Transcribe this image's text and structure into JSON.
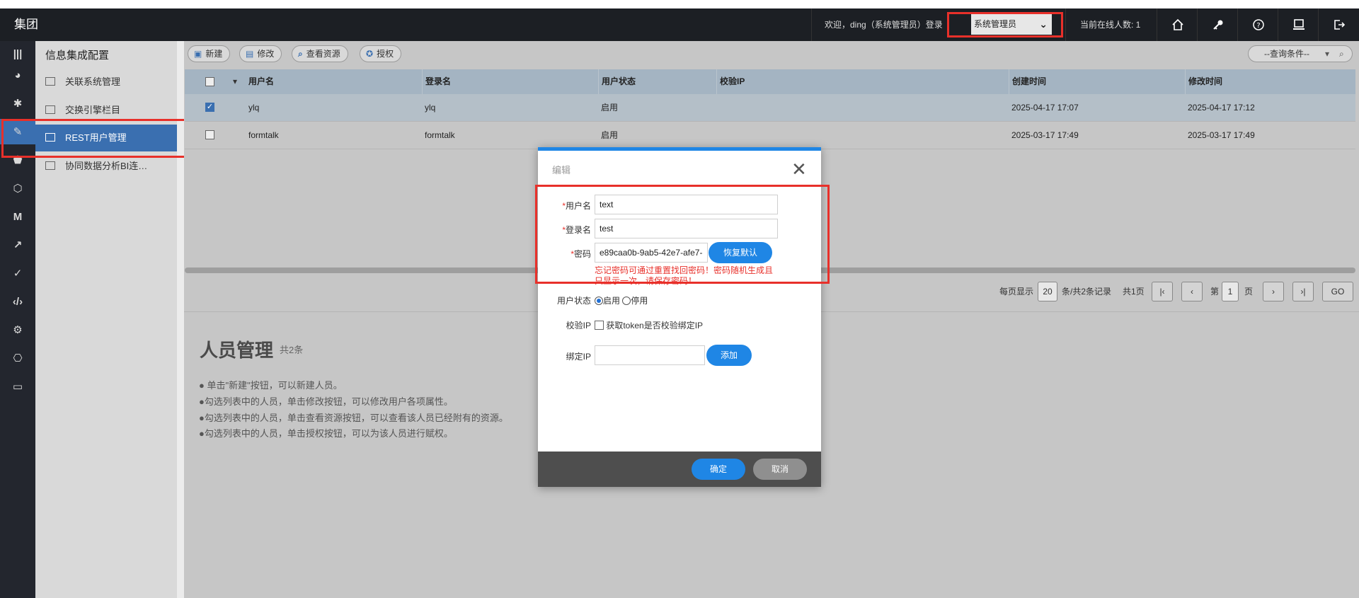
{
  "app": {
    "brand": "集团",
    "welcome": "欢迎，ding（系统管理员）登录",
    "role_selected": "系统管理员",
    "online_count": "当前在线人数: 1"
  },
  "topbar": {
    "icons": [
      "home-icon",
      "key-icon",
      "help-icon",
      "monitor-icon",
      "logout-icon"
    ]
  },
  "leftnav": {
    "icons": [
      "menu-icon",
      "dashboard-icon",
      "settings-icon",
      "pen-icon",
      "shield-icon",
      "hexagon-icon",
      "m-icon",
      "feather-icon",
      "check-icon",
      "code-icon",
      "gear-arrow-icon",
      "network-icon",
      "monitor-icon"
    ]
  },
  "submenu": {
    "title": "信息集成配置",
    "items": [
      {
        "label": "关联系统管理"
      },
      {
        "label": "交换引擎栏目"
      },
      {
        "label": "REST用户管理"
      },
      {
        "label": "协同数据分析BI连…"
      }
    ]
  },
  "toolbar": {
    "new_label": "新建",
    "edit_label": "修改",
    "view_label": "查看资源",
    "auth_label": "授权",
    "query_label": "--查询条件--"
  },
  "table": {
    "headers": [
      "用户名",
      "登录名",
      "用户状态",
      "校验IP",
      "创建时间",
      "修改时间"
    ],
    "rows": [
      {
        "username": "ylq",
        "login": "ylq",
        "status": "启用",
        "ip": "",
        "created": "2025-04-17 17:07",
        "modified": "2025-04-17 17:12",
        "checked": true
      },
      {
        "username": "formtalk",
        "login": "formtalk",
        "status": "启用",
        "ip": "",
        "created": "2025-03-17 17:49",
        "modified": "2025-03-17 17:49",
        "checked": false
      }
    ]
  },
  "pager": {
    "per_page_label": "每页显示",
    "per_page": "20",
    "summary": "条/共2条记录",
    "pages": "共1页",
    "page_label": "第",
    "page": "1",
    "page_suffix": "页",
    "go": "GO"
  },
  "help": {
    "title": "人员管理",
    "count": "共2条",
    "lines": [
      "● 单击\"新建\"按钮，可以新建人员。",
      "●勾选列表中的人员，单击修改按钮，可以修改用户各项属性。",
      "●勾选列表中的人员，单击查看资源按钮，可以查看该人员已经附有的资源。",
      "●勾选列表中的人员，单击授权按钮，可以为该人员进行赋权。"
    ]
  },
  "dialog": {
    "title": "编辑",
    "username_label": "用户名",
    "username_value": "text",
    "login_label": "登录名",
    "login_value": "test",
    "password_label": "密码",
    "password_value": "e89caa0b-9ab5-42e7-afe7-",
    "reset_label": "恢复默认",
    "warning": "忘记密码可通过重置找回密码！密码随机生成且只显示一次，请保存密码！",
    "status_label": "用户状态",
    "status_on": "启用",
    "status_off": "停用",
    "verify_label": "校验IP",
    "verify_text": "获取token是否校验绑定IP",
    "bind_label": "绑定IP",
    "bind_value": "",
    "add_label": "添加",
    "ok_label": "确定",
    "cancel_label": "取消"
  },
  "colors": {
    "accent": "#1f86e5",
    "nav_active": "#3a6fb0",
    "annotation": "#e8302a",
    "topbar": "#1c1f24"
  }
}
